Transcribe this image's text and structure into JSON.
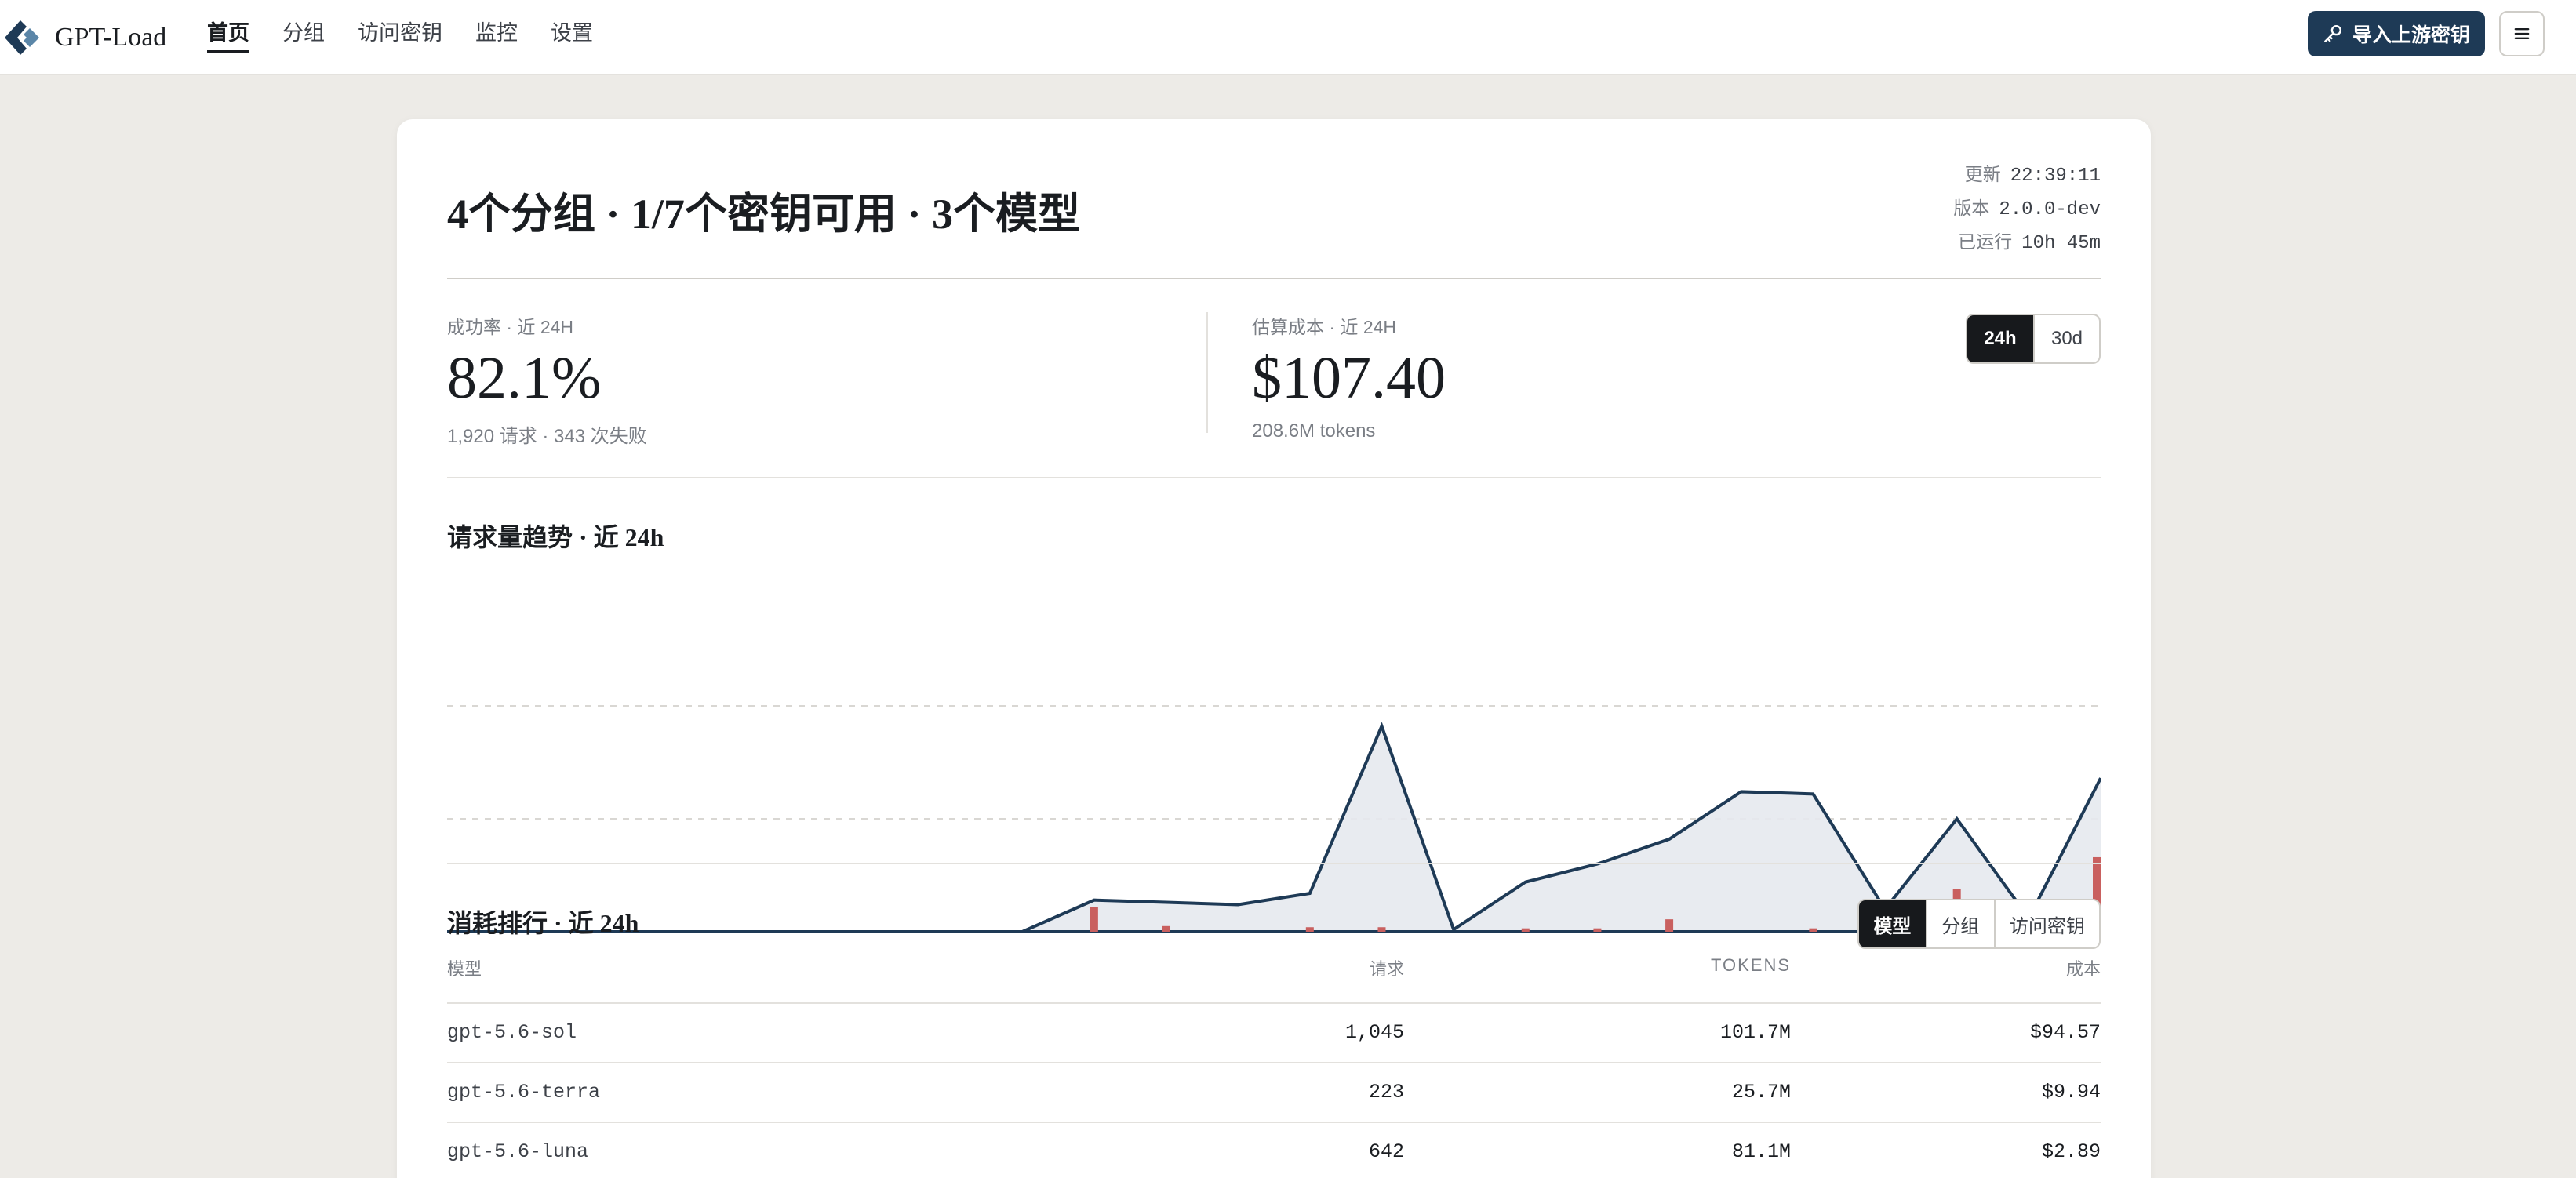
{
  "app": {
    "brand": "GPT-Load",
    "nav": [
      {
        "label": "首页",
        "active": true
      },
      {
        "label": "分组",
        "active": false
      },
      {
        "label": "访问密钥",
        "active": false
      },
      {
        "label": "监控",
        "active": false
      },
      {
        "label": "设置",
        "active": false
      }
    ],
    "import_button": "导入上游密钥",
    "import_icon": "key-icon",
    "menu_icon": "hamburger-menu-icon",
    "accent_color": "#1e3a56"
  },
  "summary": {
    "groups_count": "4",
    "groups_suffix": "个分组",
    "sep": " · ",
    "keys_ratio": "1/7",
    "keys_suffix": "个密钥可用",
    "models_count": "3",
    "models_suffix": "个模型"
  },
  "meta": {
    "updated_label": "更新",
    "updated_value": "22:39:11",
    "version_label": "版本",
    "version_value": "2.0.0-dev",
    "uptime_label": "已运行",
    "uptime_value": "10h 45m"
  },
  "stats": {
    "success_label": "成功率 · 近 24H",
    "success_value": "82.1%",
    "success_sub": "1,920 请求 · 343 次失败",
    "cost_label": "估算成本 · 近 24H",
    "cost_value": "$107.40",
    "cost_sub": "208.6M tokens"
  },
  "range_toggle": [
    {
      "label": "24h",
      "active": true
    },
    {
      "label": "30d",
      "active": false
    }
  ],
  "trend_title": "请求量趋势 · 近 24h",
  "chart_data": {
    "type": "area",
    "title": "请求量趋势 · 近 24h",
    "x": [
      0,
      1,
      2,
      3,
      4,
      5,
      6,
      7,
      8,
      9,
      10,
      11,
      12,
      13,
      14,
      15,
      16,
      17,
      18,
      19,
      20,
      21,
      22,
      23
    ],
    "ylim": [
      0,
      200
    ],
    "grid": true,
    "series": [
      {
        "values": [
          0,
          0,
          0,
          0,
          0,
          0,
          0,
          0,
          0,
          28,
          26,
          24,
          34,
          182,
          2,
          44,
          60,
          82,
          124,
          122,
          20,
          100,
          12,
          136
        ],
        "color": "#1e3a56"
      },
      {
        "values": [
          0,
          0,
          0,
          0,
          0,
          0,
          0,
          0,
          0,
          22,
          5,
          0,
          4,
          4,
          0,
          3,
          3,
          11,
          0,
          3,
          0,
          38,
          3,
          66
        ],
        "color": "#c9605f"
      }
    ]
  },
  "ranking": {
    "title": "消耗排行 · 近 24h",
    "tabs": [
      {
        "label": "模型",
        "active": true
      },
      {
        "label": "分组",
        "active": false
      },
      {
        "label": "访问密钥",
        "active": false
      }
    ],
    "columns": {
      "name": "模型",
      "requests": "请求",
      "tokens": "TOKENS",
      "cost": "成本"
    },
    "rows": [
      {
        "name": "gpt-5.6-sol",
        "requests": "1,045",
        "tokens": "101.7M",
        "cost": "$94.57"
      },
      {
        "name": "gpt-5.6-terra",
        "requests": "223",
        "tokens": "25.7M",
        "cost": "$9.94"
      },
      {
        "name": "gpt-5.6-luna",
        "requests": "642",
        "tokens": "81.1M",
        "cost": "$2.89"
      }
    ]
  }
}
